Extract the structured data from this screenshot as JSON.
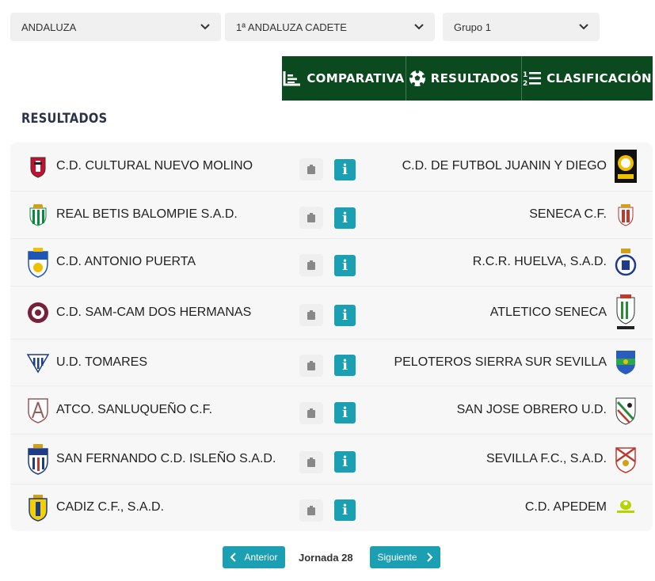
{
  "filters": {
    "region": "ANDALUZA",
    "competition": "1ª ANDALUZA CADETE",
    "group": "Grupo 1"
  },
  "tabs": [
    {
      "label": "COMPARATIVA",
      "icon": "chart-icon"
    },
    {
      "label": "RESULTADOS",
      "icon": "soccer-ball-icon"
    },
    {
      "label": "CLASIFICACIÓN",
      "icon": "ranking-list-icon"
    }
  ],
  "section_title": "RESULTADOS",
  "matches": [
    {
      "home": "C.D. CULTURAL NUEVO MOLINO",
      "away": "C.D. DE FUTBOL JUANIN Y DIEGO",
      "info": "i"
    },
    {
      "home": "REAL BETIS BALOMPIE S.A.D.",
      "away": "SENECA C.F.",
      "info": "i"
    },
    {
      "home": "C.D. ANTONIO PUERTA",
      "away": "R.C.R. HUELVA, S.A.D.",
      "info": "i"
    },
    {
      "home": "C.D. SAM-CAM DOS HERMANAS",
      "away": "ATLETICO SENECA",
      "info": "i"
    },
    {
      "home": "U.D. TOMARES",
      "away": "PELOTEROS SIERRA SUR SEVILLA",
      "info": "i"
    },
    {
      "home": "ATCO. SANLUQUEÑO C.F.",
      "away": "SAN JOSE OBRERO U.D.",
      "info": "i"
    },
    {
      "home": "SAN FERNANDO C.D. ISLEÑO S.A.D.",
      "away": "SEVILLA F.C., S.A.D.",
      "info": "i"
    },
    {
      "home": "CADIZ C.F., S.A.D.",
      "away": "C.D. APEDEM",
      "info": "i"
    }
  ],
  "pager": {
    "prev": "Anterior",
    "label": "Jornada 28",
    "next": "Siguiente"
  },
  "colors": {
    "tab_bg": "#0a4a1e",
    "accent": "#1a9fb3"
  }
}
